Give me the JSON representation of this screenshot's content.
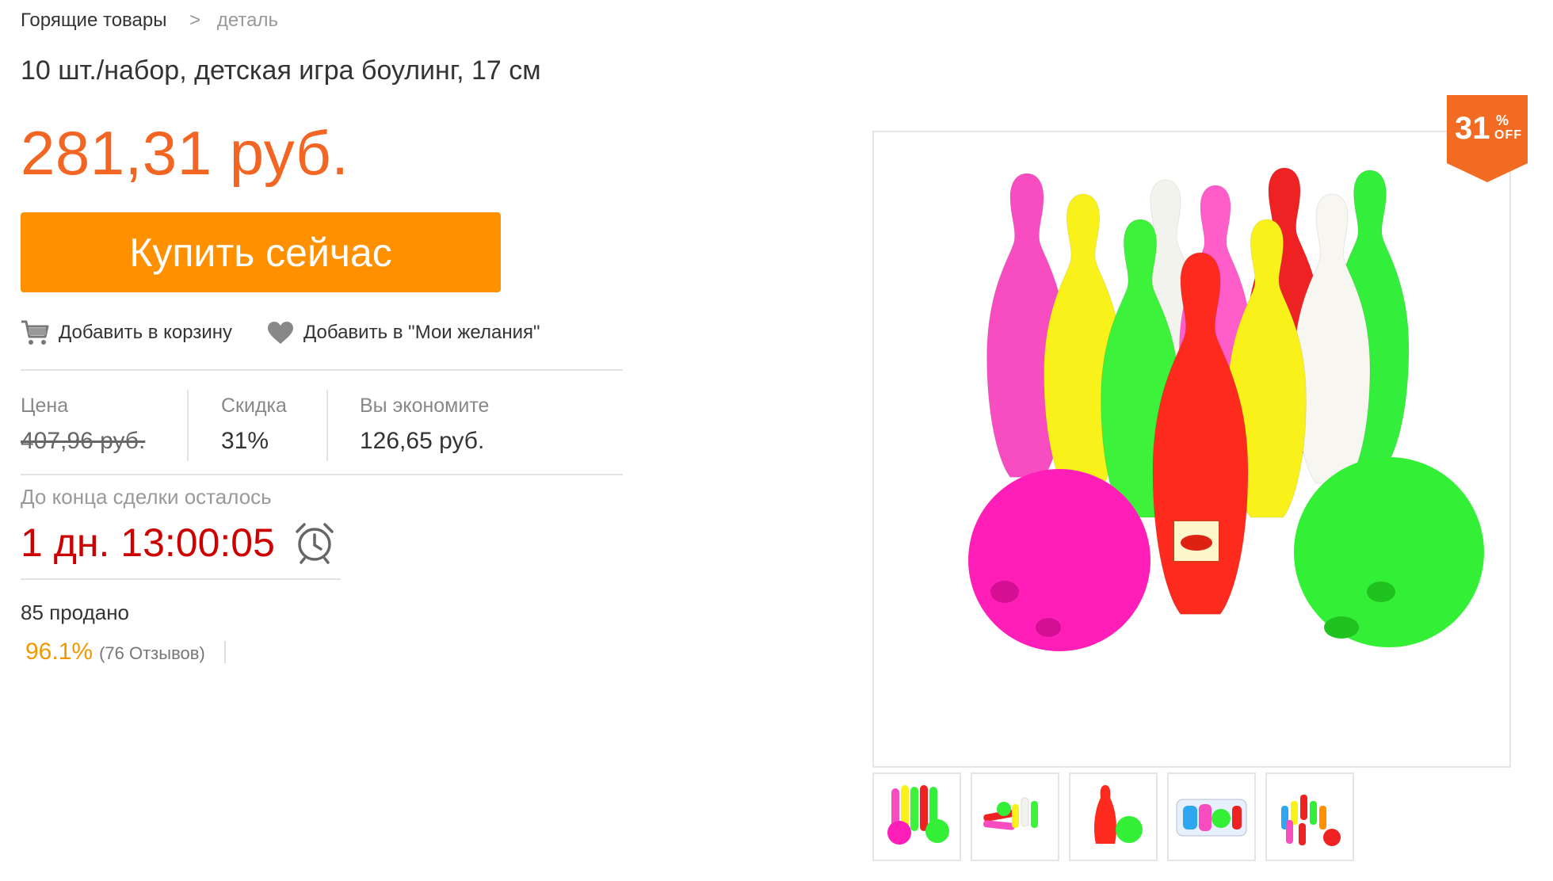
{
  "breadcrumb": {
    "home": "Горящие товары",
    "separator": ">",
    "current": "деталь"
  },
  "product": {
    "title": "10 шт./набор, детская игра боулинг, 17 см",
    "price": "281,31 руб."
  },
  "buy_button": "Купить сейчас",
  "actions": {
    "cart": "Добавить в корзину",
    "wishlist": "Добавить в \"Мои желания\""
  },
  "stats": {
    "price_label": "Цена",
    "price_value": "407,96 руб.",
    "discount_label": "Скидка",
    "discount_value": "31%",
    "save_label": "Вы экономите",
    "save_value": "126,65 руб."
  },
  "deal": {
    "label": "До конца сделки осталось",
    "countdown": "1 дн. 13:00:05"
  },
  "sold": "85 продано",
  "rating": {
    "percent": "96.1%",
    "reviews": "(76 Отзывов)"
  },
  "badge": {
    "number": "31",
    "percent_sign": "%",
    "off": "OFF"
  },
  "colors": {
    "accent": "#f26522",
    "button": "#ff9000",
    "countdown": "#cc0000",
    "rating": "#f39800"
  },
  "icons": [
    "cart-icon",
    "heart-icon",
    "alarm-clock-icon"
  ],
  "thumbnails": [
    "thumbnail-1",
    "thumbnail-2",
    "thumbnail-3",
    "thumbnail-4",
    "thumbnail-5"
  ]
}
